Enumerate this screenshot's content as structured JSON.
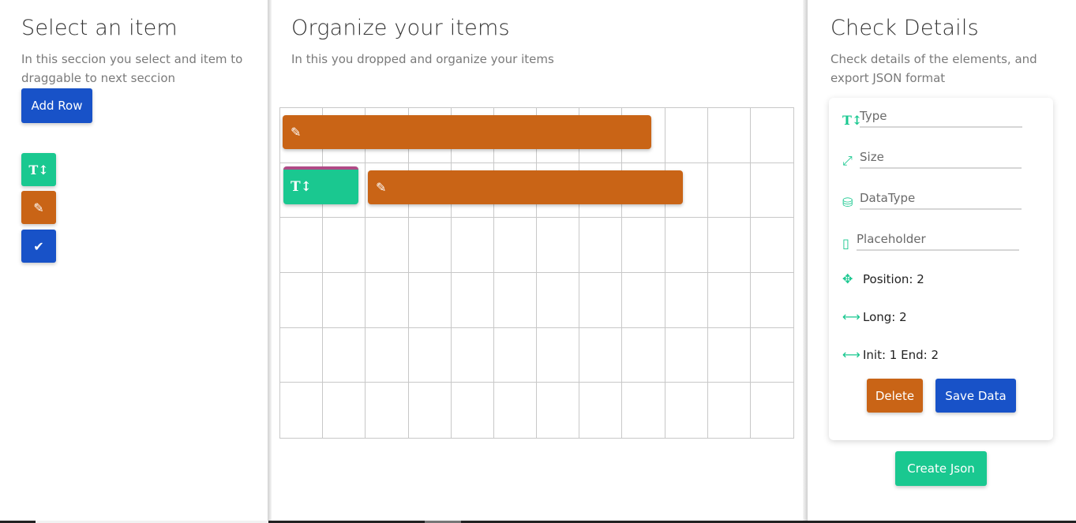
{
  "select_panel": {
    "title": "Select an item",
    "subtitle": "In this seccion you select and item to draggable to next seccion",
    "add_row_label": "Add Row",
    "tools": [
      {
        "icon": "text-height-icon",
        "glyph": "T↕",
        "color": "#1ac890"
      },
      {
        "icon": "edit-icon",
        "glyph": "✎",
        "color": "#c96416"
      },
      {
        "icon": "check-icon",
        "glyph": "✔",
        "color": "#1852c8"
      }
    ]
  },
  "organize_panel": {
    "title": "Organize your items",
    "subtitle": "In this you dropped and organize your items",
    "grid": {
      "columns": 12,
      "rows": 6
    },
    "placed_items": [
      {
        "type": "input",
        "icon": "edit-icon",
        "glyph": "✎",
        "color": "#c96416"
      },
      {
        "type": "text",
        "icon": "text-height-icon",
        "glyph": "T↕",
        "color": "#1ac890",
        "selected": true
      },
      {
        "type": "input",
        "icon": "edit-icon",
        "glyph": "✎",
        "color": "#c96416"
      }
    ]
  },
  "details_panel": {
    "title": "Check Details",
    "subtitle": "Check details of the elements, and export JSON format",
    "fields": {
      "type_placeholder": "Type",
      "size_placeholder": "Size",
      "datatype_placeholder": "DataType",
      "placeholder_placeholder": "Placeholder"
    },
    "position_text": "Position: 2",
    "long_text": "Long: 2",
    "init_end_text": "Init: 1 End: 2",
    "delete_label": "Delete",
    "save_label": "Save Data",
    "create_json_label": "Create Json"
  },
  "colors": {
    "teal": "#1ac890",
    "orange": "#c96416",
    "blue": "#1852c8",
    "selected_border": "#b04a86"
  }
}
